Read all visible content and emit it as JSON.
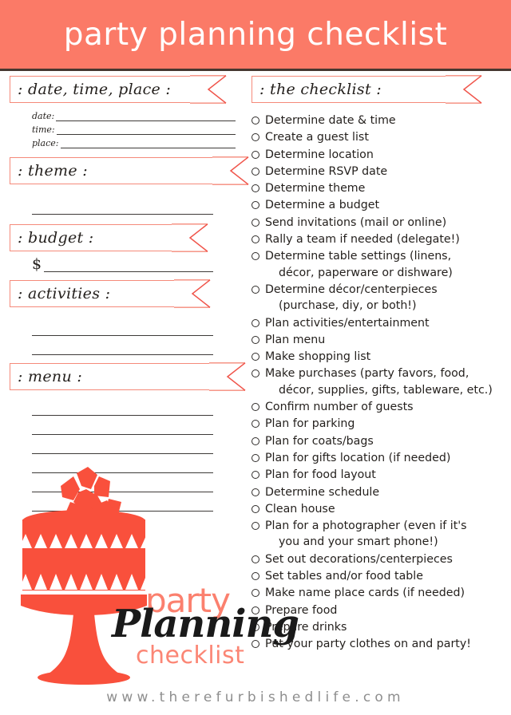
{
  "header": {
    "title": "party planning checklist",
    "band_color": "#fb7a67",
    "rule_color": "#463730"
  },
  "accent_color": "#fb7a67",
  "ribbon_outline_color": "#f58a7a",
  "left_column": {
    "sections": [
      {
        "id": "date-time-place",
        "label": ": date, time, place :",
        "ribbon_width": 248,
        "fields": [
          {
            "label": "date:"
          },
          {
            "label": "time:"
          },
          {
            "label": "place:"
          }
        ]
      },
      {
        "id": "theme",
        "label": ": theme :",
        "ribbon_width": 276,
        "blank_lines": 1
      },
      {
        "id": "budget",
        "label": ": budget :",
        "ribbon_width": 225,
        "currency_symbol": "$"
      },
      {
        "id": "activities",
        "label": ": activities :",
        "ribbon_width": 228,
        "blank_lines": 2
      },
      {
        "id": "menu",
        "label": ": menu :",
        "ribbon_width": 272,
        "blank_lines": 6
      }
    ]
  },
  "right_column": {
    "section_label": ": the checklist :",
    "ribbon_width": 265,
    "items": [
      {
        "text": "Determine date & time"
      },
      {
        "text": "Create a guest list"
      },
      {
        "text": "Determine location"
      },
      {
        "text": "Determine RSVP date"
      },
      {
        "text": "Determine theme"
      },
      {
        "text": "Determine a budget"
      },
      {
        "text": "Send invitations (mail or online)"
      },
      {
        "text": "Rally a team if needed (delegate!)"
      },
      {
        "text": "Determine table settings (linens,",
        "cont": "décor, paperware or dishware)"
      },
      {
        "text": "Determine décor/centerpieces",
        "cont": "(purchase, diy, or both!)"
      },
      {
        "text": "Plan activities/entertainment"
      },
      {
        "text": "Plan menu"
      },
      {
        "text": "Make shopping list"
      },
      {
        "text": "Make purchases (party favors, food,",
        "cont": "décor, supplies, gifts, tableware, etc.)"
      },
      {
        "text": "Confirm number of guests"
      },
      {
        "text": "Plan for parking"
      },
      {
        "text": "Plan for coats/bags"
      },
      {
        "text": "Plan for gifts location (if needed)"
      },
      {
        "text": "Plan for food layout"
      },
      {
        "text": "Determine schedule"
      },
      {
        "text": "Clean house"
      },
      {
        "text": "Plan for a photographer (even if it's",
        "cont": "you and your smart phone!)"
      },
      {
        "text": "Set out decorations/centerpieces"
      },
      {
        "text": "Set tables and/or food table"
      },
      {
        "text": "Make name place cards (if needed)"
      },
      {
        "text": "Prepare food"
      },
      {
        "text": "Prepare drinks"
      },
      {
        "text": "Put your party clothes on and party!"
      }
    ]
  },
  "logo": {
    "line1": "party",
    "line2": "Planning",
    "line3": "checklist"
  },
  "illustration": {
    "name": "party-cake-on-stand",
    "color": "#f9503c"
  },
  "footer": {
    "url": "www.therefurbishedlife.com"
  }
}
